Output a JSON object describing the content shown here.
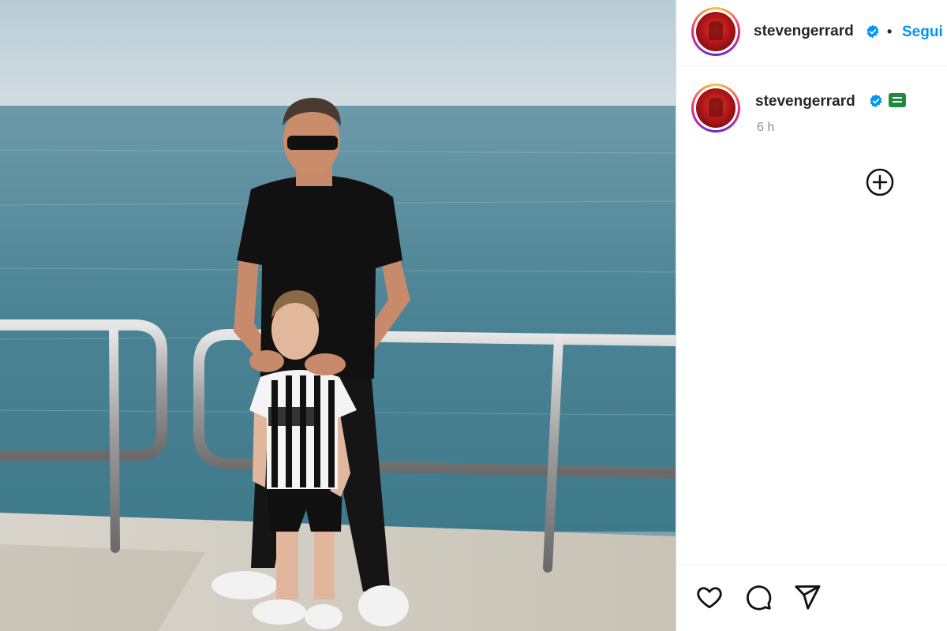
{
  "photo": {
    "icon": "photo",
    "alt": ""
  },
  "header": {
    "username": "stevengerrard",
    "separator": "•",
    "follow_label": "Segui"
  },
  "caption": {
    "username": "stevengerrard",
    "timestamp": "6 h"
  },
  "icons": {
    "verified": "verified-badge-icon",
    "badge": "green-badge-icon",
    "more": "plus-circle-icon",
    "like": "heart-icon",
    "comment": "comment-icon",
    "share": "send-icon"
  },
  "colors": {
    "follow": "#0095f6",
    "verified": "#0095f6",
    "badge": "#1f8a3e",
    "muted": "#8e8e8e"
  }
}
